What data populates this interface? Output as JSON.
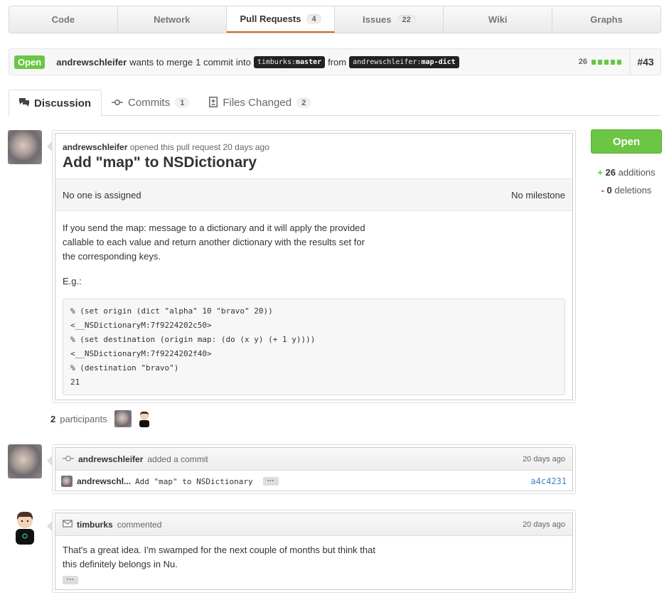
{
  "nav": {
    "items": [
      {
        "label": "Code",
        "count": null
      },
      {
        "label": "Network",
        "count": null
      },
      {
        "label": "Pull Requests",
        "count": "4"
      },
      {
        "label": "Issues",
        "count": "22"
      },
      {
        "label": "Wiki",
        "count": null
      },
      {
        "label": "Graphs",
        "count": null
      }
    ]
  },
  "pull": {
    "state": "Open",
    "author": "andrewschleifer",
    "merge_text_1": "wants to merge",
    "commit_count_text": "1 commit",
    "merge_text_2": "into",
    "base_user": "timburks",
    "base_branch": "master",
    "from_text": "from",
    "head_user": "andrewschleifer",
    "head_branch": "map-dict",
    "diffstat": "26",
    "number": "#43"
  },
  "tabs": [
    {
      "label": "Discussion",
      "count": null
    },
    {
      "label": "Commits",
      "count": "1"
    },
    {
      "label": "Files Changed",
      "count": "2"
    }
  ],
  "opener": {
    "author": "andrewschleifer",
    "meta_text": "opened this pull request 20 days ago",
    "title": "Add \"map\" to NSDictionary",
    "assignee": "No one is assigned",
    "milestone": "No milestone",
    "para1": "If you send the map: message to a dictionary and it will apply the provided callable to each value and return another dictionary with the results set for the corresponding keys.",
    "para2": "E.g.:",
    "code": "% (set origin (dict \"alpha\" 10 \"bravo\" 20))\n<__NSDictionaryM:7f9224202c50>\n% (set destination (origin map: (do (x y) (+ 1 y))))\n<__NSDictionaryM:7f9224202f40>\n% (destination \"bravo\")\n21"
  },
  "sidebar": {
    "state_button": "Open",
    "additions_count": "26",
    "additions_label": "additions",
    "deletions_count": "0",
    "deletions_label": "deletions",
    "plus": "+",
    "minus": "-"
  },
  "participants": {
    "count": "2",
    "label": "participants"
  },
  "commit_event": {
    "author": "andrewschleifer",
    "action": "added a commit",
    "time": "20 days ago",
    "row_author": "andrewschl...",
    "message": "Add \"map\" to NSDictionary",
    "ellipsis": "···",
    "sha": "a4c4231"
  },
  "comment": {
    "author": "timburks",
    "action": "commented",
    "time": "20 days ago",
    "text": "That's a great idea. I'm swamped for the next couple of months but think that this definitely belongs in Nu.",
    "ellipsis": "···"
  },
  "colors": {
    "open_green": "#6cc644",
    "accent_orange": "#d26911",
    "link_blue": "#4183c4"
  }
}
